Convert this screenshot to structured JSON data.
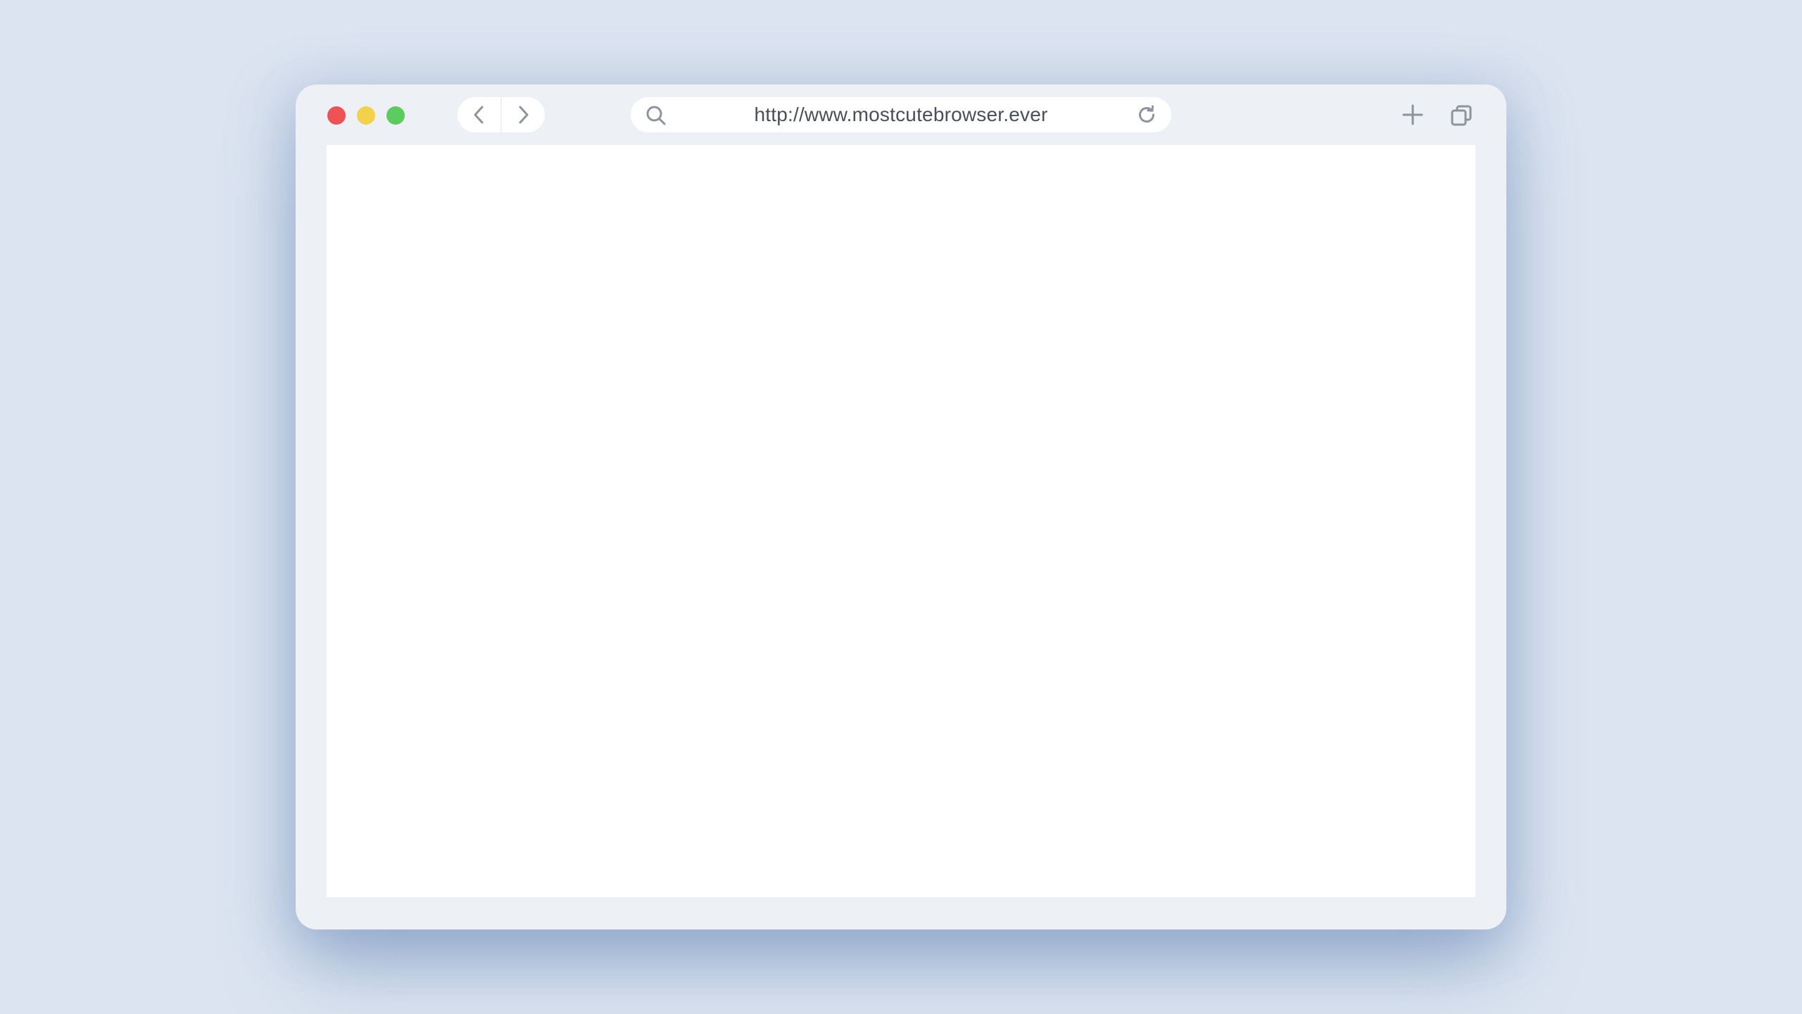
{
  "window": {
    "colors": {
      "close": "#ee5255",
      "minimize": "#f2d14b",
      "maximize": "#5bcc5d",
      "icon": "#8d949c",
      "frame": "#edf1f5",
      "background": "#dbe4f0"
    }
  },
  "toolbar": {
    "back_icon": "chevron-left-icon",
    "forward_icon": "chevron-right-icon",
    "new_tab_icon": "plus-icon",
    "tabs_icon": "tabs-overview-icon"
  },
  "address_bar": {
    "url": "http://www.mostcutebrowser.ever",
    "search_icon": "search-icon",
    "reload_icon": "reload-icon"
  }
}
